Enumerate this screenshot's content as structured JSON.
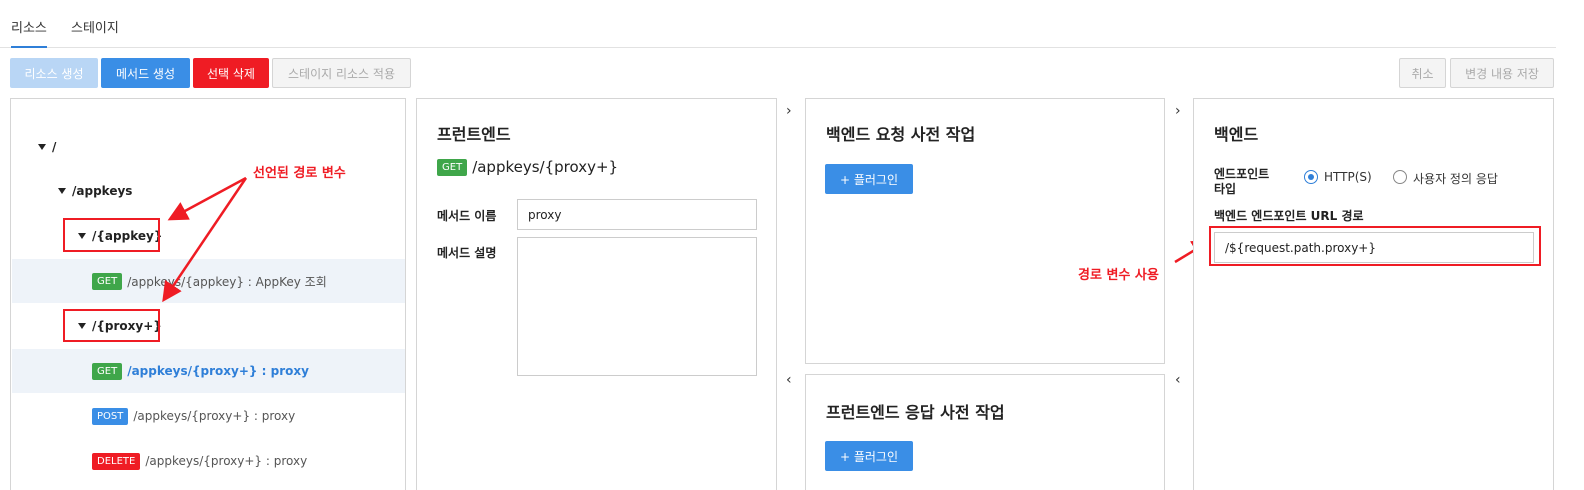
{
  "tabs": [
    {
      "label": "리소스",
      "active": true
    },
    {
      "label": "스테이지",
      "active": false
    }
  ],
  "toolbar": {
    "create_resource": "리소스 생성",
    "create_method": "메서드 생성",
    "delete_selected": "선택 삭제",
    "apply_stage": "스테이지 리소스 적용",
    "cancel": "취소",
    "save_changes": "변경 내용 저장"
  },
  "tree": {
    "root": "/",
    "appkeys": "/appkeys",
    "appkey_var": "/{appkey}",
    "appkey_get": {
      "method": "GET",
      "text": "/appkeys/{appkey} : AppKey 조회"
    },
    "proxy_var": "/{proxy+}",
    "proxy_get": {
      "method": "GET",
      "text": "/appkeys/{proxy+} : proxy"
    },
    "proxy_post": {
      "method": "POST",
      "text": "/appkeys/{proxy+} : proxy"
    },
    "proxy_delete": {
      "method": "DELETE",
      "text": "/appkeys/{proxy+} : proxy"
    }
  },
  "annotations": {
    "declared_path_var": "선언된 경로 변수",
    "use_path_var": "경로 변수 사용"
  },
  "frontend": {
    "title": "프런트엔드",
    "method": "GET",
    "path": "/appkeys/{proxy+}",
    "method_name_label": "메서드 이름",
    "method_name_value": "proxy",
    "method_desc_label": "메서드 설명",
    "method_desc_value": ""
  },
  "backend_request": {
    "title": "백엔드 요청 사전 작업",
    "plugin_button": "+ 플러그인"
  },
  "frontend_response": {
    "title": "프런트엔드 응답 사전 작업",
    "plugin_button": "+ 플러그인"
  },
  "backend": {
    "title": "백엔드",
    "endpoint_type_label": "엔드포인트 타입",
    "option_http": "HTTP(S)",
    "option_custom": "사용자 정의 응답",
    "url_label": "백엔드 엔드포인트 URL 경로",
    "url_value": "/${request.path.proxy+}"
  },
  "icons": {
    "chevron_right": "›",
    "chevron_left": "‹"
  },
  "colors": {
    "accent": "#3a8ee6",
    "danger": "#ef1c24",
    "get": "#3fa64a"
  }
}
